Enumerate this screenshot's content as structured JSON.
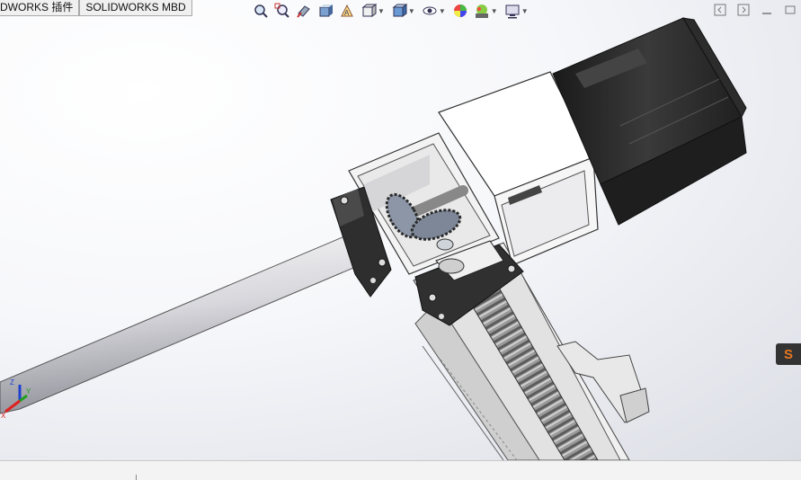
{
  "tabs": [
    {
      "label": "DWORKS 插件"
    },
    {
      "label": "SOLIDWORKS MBD"
    }
  ],
  "toolbar": {
    "icons": [
      "zoom-to-fit-icon",
      "zoom-to-area-icon",
      "previous-view-icon",
      "section-view-icon",
      "dynamic-annotation-icon",
      "view-orientation-icon",
      "display-style-icon",
      "hide-show-items-icon",
      "edit-appearance-icon",
      "apply-scene-icon",
      "view-settings-icon"
    ]
  },
  "window_controls": {
    "icons": [
      "restore-left-icon",
      "restore-right-icon",
      "minimize-icon",
      "maximize-icon"
    ]
  },
  "triad": {
    "z_label": "Z",
    "y_label": "Y",
    "x_label": "X"
  },
  "side_badge": {
    "label": "S"
  },
  "colors": {
    "viewport_light": "#ffffff",
    "viewport_dark": "#dcdee6",
    "part_dark": "#2e2e2e",
    "part_light": "#f2f2f2",
    "triad_x": "#e02020",
    "triad_y": "#20a020",
    "triad_z": "#2040d0"
  }
}
